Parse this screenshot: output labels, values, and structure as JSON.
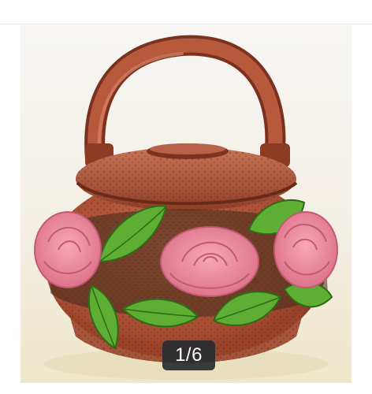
{
  "viewer": {
    "image_description": "product-photo",
    "counter_text": "1/6",
    "current_index": 1,
    "total_images": 6
  },
  "colors": {
    "terracotta": "#b4573a",
    "rose": "#e9879c",
    "leaf": "#5fae34",
    "counter_bg": "#2c3034"
  }
}
